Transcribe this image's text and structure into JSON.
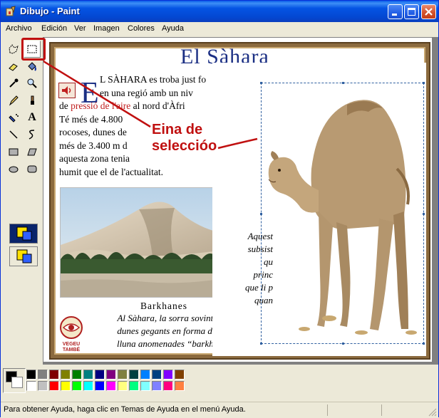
{
  "window": {
    "title": "Dibujo - Paint",
    "accent": "#0554e3"
  },
  "menu": [
    {
      "label": "Archivo",
      "key": "A"
    },
    {
      "label": "Edición",
      "key": "E"
    },
    {
      "label": "Ver",
      "key": "V"
    },
    {
      "label": "Imagen",
      "key": "I"
    },
    {
      "label": "Colores",
      "key": "C"
    },
    {
      "label": "Ayuda",
      "key": "y"
    }
  ],
  "tools": [
    {
      "name": "free-form-select-icon"
    },
    {
      "name": "rect-select-icon",
      "active": true
    },
    {
      "name": "eraser-icon"
    },
    {
      "name": "fill-icon"
    },
    {
      "name": "color-picker-icon"
    },
    {
      "name": "magnifier-icon"
    },
    {
      "name": "pencil-icon"
    },
    {
      "name": "brush-icon"
    },
    {
      "name": "airbrush-icon"
    },
    {
      "name": "text-icon",
      "glyph": "A"
    },
    {
      "name": "line-icon"
    },
    {
      "name": "curve-icon"
    },
    {
      "name": "rectangle-icon"
    },
    {
      "name": "polygon-icon"
    },
    {
      "name": "ellipse-icon"
    },
    {
      "name": "rounded-rect-icon"
    }
  ],
  "document": {
    "title": "El Sàhara",
    "dropcap": "E",
    "paragraph": [
      {
        "text": "L SÀHARA es troba just fo"
      },
      {
        "text": "en una regió amb un niv"
      },
      {
        "pre": "de ",
        "red": "pressió de l'aire",
        "post": " al nord d'Àfri"
      },
      {
        "text": "Té més de 4.800"
      },
      {
        "text": "rocoses, dunes de"
      },
      {
        "text": "més de 3.400 m d"
      },
      {
        "text": "aquesta zona tenia"
      },
      {
        "text": "humit que el de l'actualitat."
      }
    ],
    "photo_caption_title": "Barkhanes",
    "photo_caption": [
      "Al Sàhara, la sorra sovint forma",
      "dunes gegants en forma de mitja",
      "lluna anomenades “barkhanes”."
    ],
    "vegeu": [
      "VEGEU",
      "TAMBÉ"
    ],
    "right_text": [
      "Aquest",
      "subsist",
      "qu",
      "",
      "princ",
      "que li p",
      "quan"
    ]
  },
  "callout": {
    "label": [
      "Eina de",
      "seleccióo"
    ]
  },
  "palette": {
    "colors_top": [
      "#000000",
      "#808080",
      "#800000",
      "#808000",
      "#008000",
      "#008080",
      "#000080",
      "#800080",
      "#808040",
      "#004040",
      "#0080ff",
      "#004080",
      "#8000ff",
      "#804000"
    ],
    "colors_bottom": [
      "#ffffff",
      "#c0c0c0",
      "#ff0000",
      "#ffff00",
      "#00ff00",
      "#00ffff",
      "#0000ff",
      "#ff00ff",
      "#ffff80",
      "#00ff80",
      "#80ffff",
      "#8080ff",
      "#ff0080",
      "#ff8040"
    ]
  },
  "status": {
    "text": "Para obtener Ayuda, haga clic en Temas de Ayuda en el menú Ayuda."
  }
}
